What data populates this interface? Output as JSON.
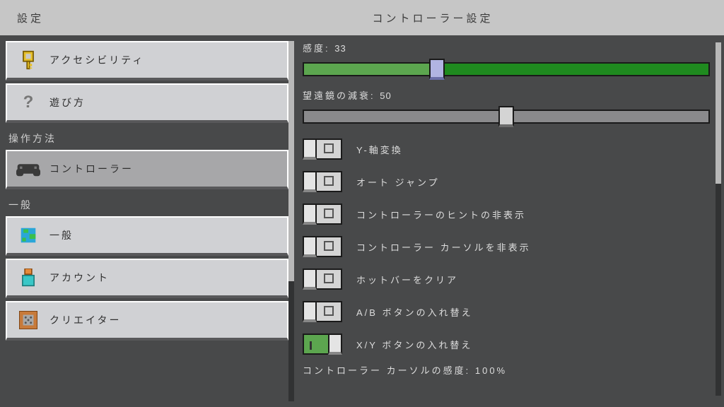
{
  "header": {
    "title_left": "設定",
    "title_center": "コントローラー設定"
  },
  "sidebar": {
    "sections": [
      {
        "header": null,
        "items": [
          {
            "id": "accessibility",
            "label": "アクセシビリティ",
            "icon": "key-icon",
            "selected": false
          },
          {
            "id": "howto",
            "label": "遊び方",
            "icon": "question-icon",
            "selected": false
          }
        ]
      },
      {
        "header": "操作方法",
        "items": [
          {
            "id": "controller",
            "label": "コントローラー",
            "icon": "controller-icon",
            "selected": true
          }
        ]
      },
      {
        "header": "一般",
        "items": [
          {
            "id": "general",
            "label": "一般",
            "icon": "globe-icon",
            "selected": false
          },
          {
            "id": "account",
            "label": "アカウント",
            "icon": "account-icon",
            "selected": false
          },
          {
            "id": "creator",
            "label": "クリエイター",
            "icon": "creator-icon",
            "selected": false
          }
        ]
      }
    ]
  },
  "sliders": {
    "sensitivity": {
      "label": "感度",
      "value": 33,
      "fill": 33
    },
    "spyglass": {
      "label": "望遠鏡の減衰",
      "value": 50,
      "fill": 50
    }
  },
  "toggles": [
    {
      "id": "invert_y",
      "label": "Y-軸変換",
      "on": false
    },
    {
      "id": "auto_jump",
      "label": "オート ジャンプ",
      "on": false
    },
    {
      "id": "hide_hints",
      "label": "コントローラーのヒントの非表示",
      "on": false
    },
    {
      "id": "hide_cursor",
      "label": "コントローラー カーソルを非表示",
      "on": false
    },
    {
      "id": "clear_hotbar",
      "label": "ホットバーをクリア",
      "on": false
    },
    {
      "id": "swap_ab",
      "label": "A/B ボタンの入れ替え",
      "on": false
    },
    {
      "id": "swap_xy",
      "label": "X/Y ボタンの入れ替え",
      "on": true
    }
  ],
  "bottom": {
    "label": "コントローラー カーソルの感度",
    "value": "100%"
  }
}
